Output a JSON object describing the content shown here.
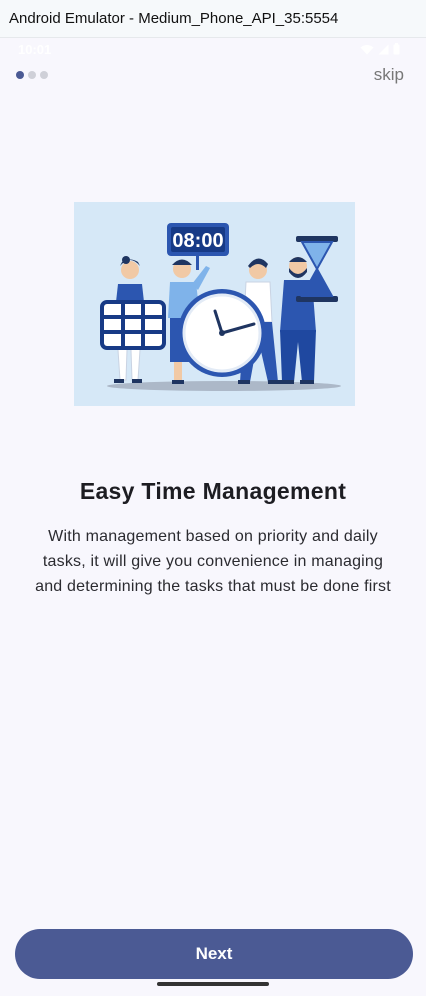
{
  "window": {
    "title": "Android Emulator - Medium_Phone_API_35:5554"
  },
  "status_bar": {
    "time": "10:01"
  },
  "onboarding": {
    "page_indicator": {
      "total": 3,
      "active": 1
    },
    "skip_label": "skip",
    "illustration": {
      "clock_text": "08:00"
    },
    "title": "Easy Time Management",
    "description": "With management based on priority and daily tasks, it will give you convenience in managing and determining the tasks that must be done first",
    "next_label": "Next"
  },
  "colors": {
    "accent": "#4b5a94",
    "background": "#f8f7fd",
    "illustration_bg": "#d6e8f7",
    "illustration_blue": "#2c56b0"
  }
}
